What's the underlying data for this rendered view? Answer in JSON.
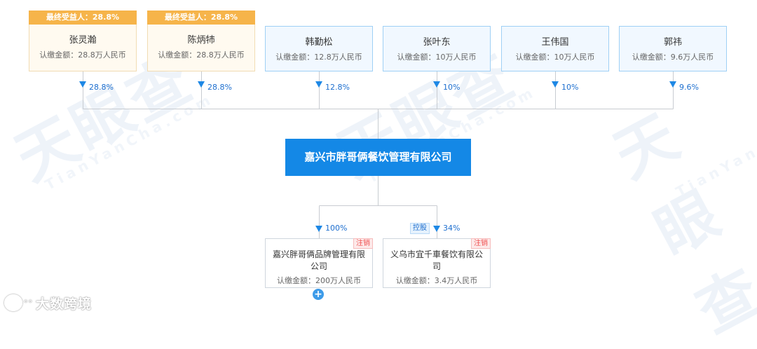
{
  "shareholders": [
    {
      "name": "张灵瀚",
      "amount": "认缴金额：28.8万人民币",
      "ratio": "28.8%",
      "beneficiary": "最终受益人：28.8%"
    },
    {
      "name": "陈炳㸬",
      "amount": "认缴金额：28.8万人民币",
      "ratio": "28.8%",
      "beneficiary": "最终受益人：28.8%"
    },
    {
      "name": "韩勤松",
      "amount": "认缴金额：12.8万人民币",
      "ratio": "12.8%"
    },
    {
      "name": "张叶东",
      "amount": "认缴金额：10万人民币",
      "ratio": "10%"
    },
    {
      "name": "王伟国",
      "amount": "认缴金额：10万人民币",
      "ratio": "10%"
    },
    {
      "name": "郭祎",
      "amount": "认缴金额：9.6万人民币",
      "ratio": "9.6%"
    }
  ],
  "company": {
    "name": "嘉兴市胖哥俩餐饮管理有限公司"
  },
  "subsidiaries": [
    {
      "name": "嘉兴胖哥俩品牌管理有限公司",
      "amount": "认缴金额：200万人民币",
      "ratio": "100%",
      "status": "注销"
    },
    {
      "name": "义乌市宜千車餐饮有限公司",
      "amount": "认缴金额：3.4万人民币",
      "ratio": "34%",
      "status": "注销",
      "control_tag": "控股"
    }
  ],
  "watermark": {
    "cn": "天眼查",
    "en": "TianYanCha.com"
  },
  "brand": {
    "dots": "°°",
    "name": "大数跨境"
  },
  "colors": {
    "accent": "#1488e6",
    "beneficiary": "#f6b44a",
    "cancel": "#f05050"
  }
}
